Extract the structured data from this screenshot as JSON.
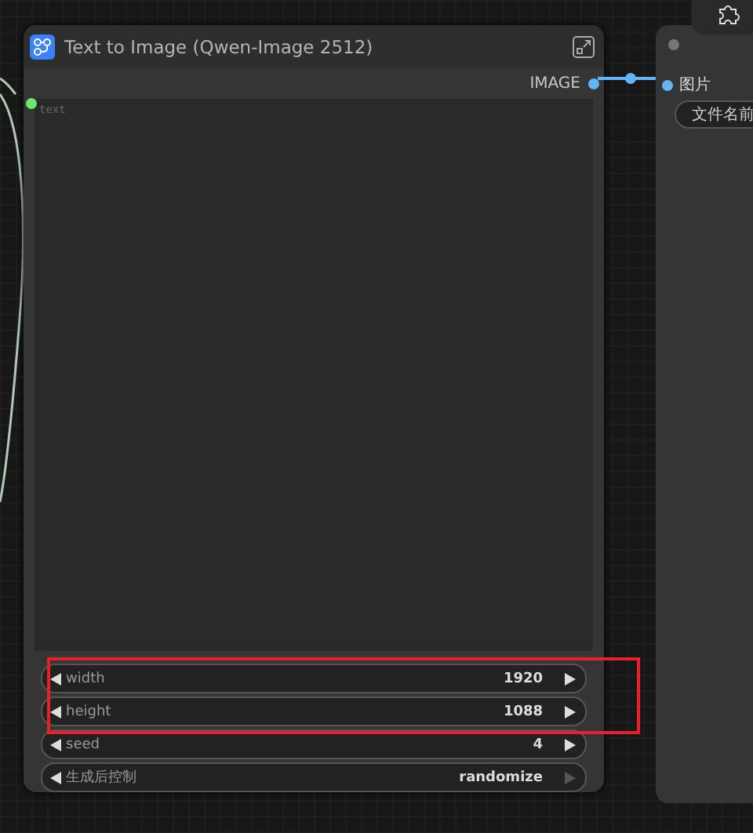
{
  "node": {
    "title": "Text to Image (Qwen-Image 2512)",
    "output": "IMAGE",
    "text_placeholder": "text",
    "widgets": [
      {
        "label": "width",
        "value": "1920",
        "disabled": false
      },
      {
        "label": "height",
        "value": "1088",
        "disabled": false
      },
      {
        "label": "seed",
        "value": "4",
        "disabled": false
      },
      {
        "label": "生成后控制",
        "value": "randomize",
        "disabled": true
      }
    ]
  },
  "save_node": {
    "input": "图片",
    "field": "文件名前"
  },
  "annotation": {
    "kind": "box",
    "color": "#e8202a"
  }
}
